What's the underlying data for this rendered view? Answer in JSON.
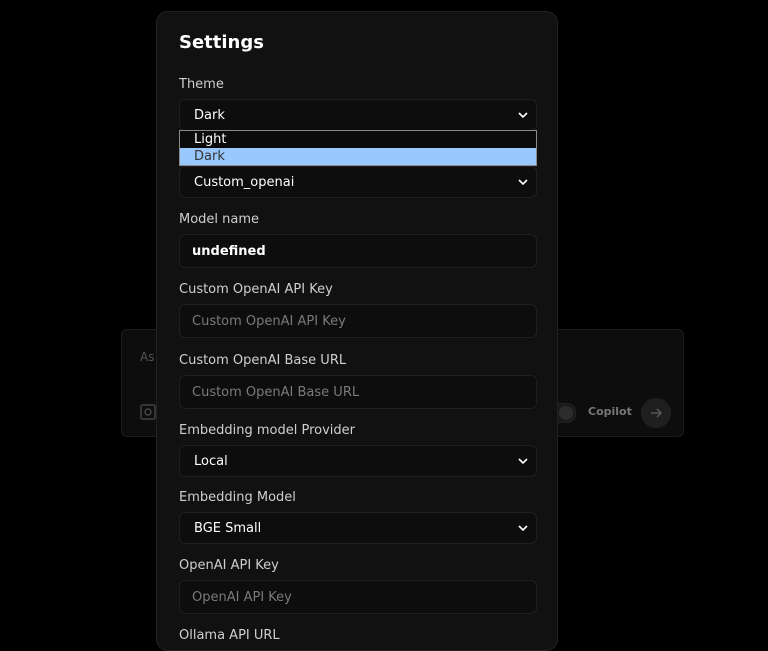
{
  "background": {
    "placeholder": "As",
    "copilot_label": "Copilot"
  },
  "settings": {
    "title": "Settings",
    "theme": {
      "label": "Theme",
      "selected": "Dark",
      "options": [
        "Light",
        "Dark"
      ],
      "highlighted": "Dark"
    },
    "chat_provider": {
      "selected": "Custom_openai"
    },
    "model_name": {
      "label": "Model name",
      "value": "undefined"
    },
    "custom_openai_key": {
      "label": "Custom OpenAI API Key",
      "placeholder": "Custom OpenAI API Key"
    },
    "custom_openai_url": {
      "label": "Custom OpenAI Base URL",
      "placeholder": "Custom OpenAI Base URL"
    },
    "embedding_provider": {
      "label": "Embedding model Provider",
      "selected": "Local"
    },
    "embedding_model": {
      "label": "Embedding Model",
      "selected": "BGE Small"
    },
    "openai_key": {
      "label": "OpenAI API Key",
      "placeholder": "OpenAI API Key"
    },
    "ollama_url": {
      "label": "Ollama API URL"
    }
  },
  "colors": {
    "highlight": "#99c8ff",
    "modal_bg": "#111111",
    "page_bg": "#000000"
  }
}
